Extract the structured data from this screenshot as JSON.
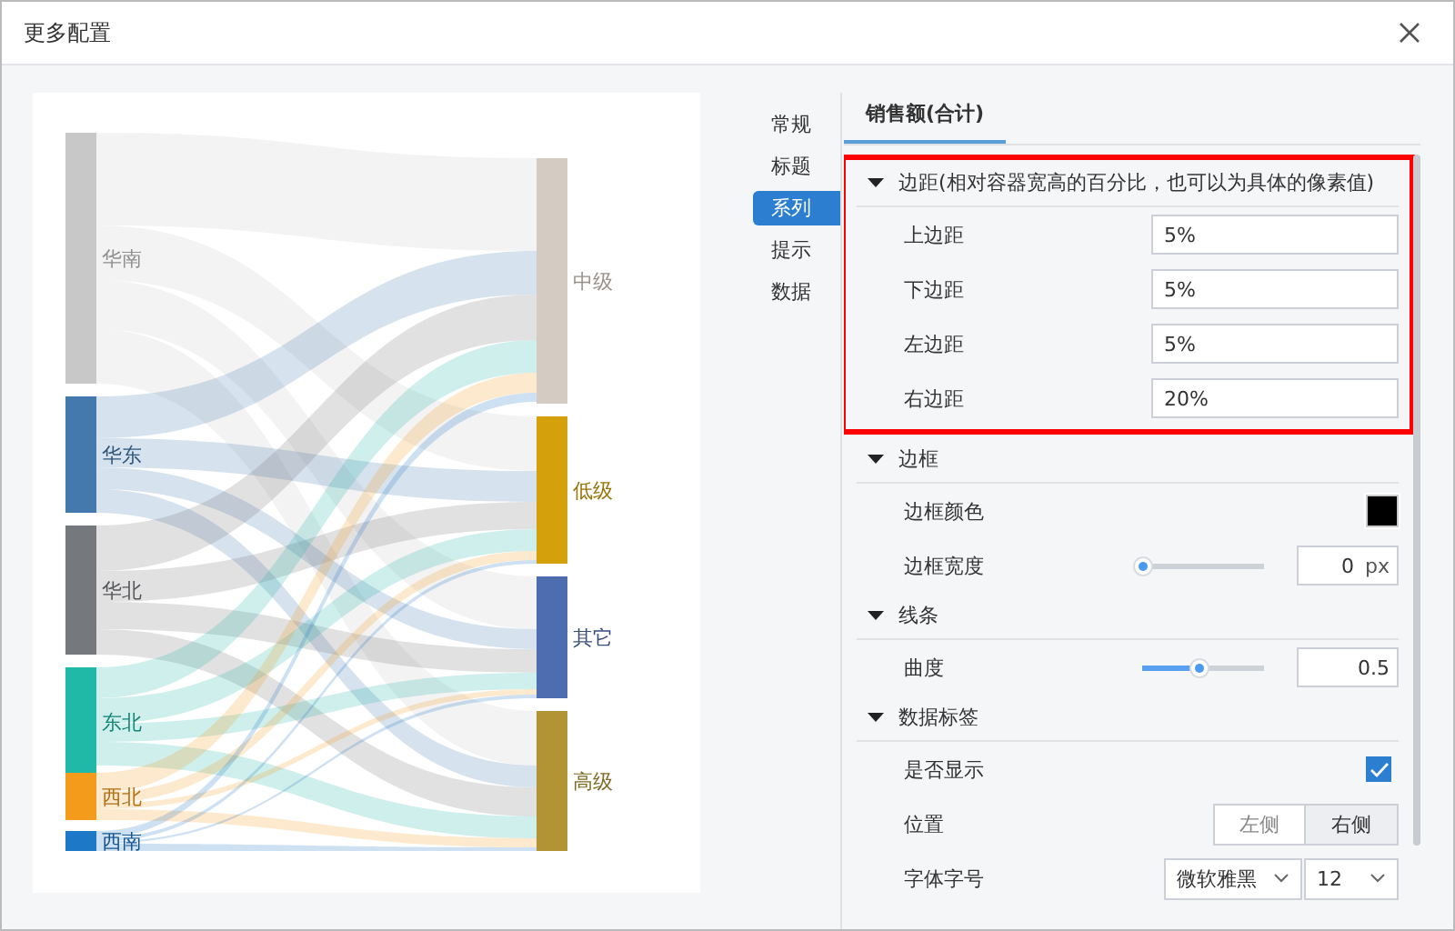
{
  "window": {
    "title": "更多配置"
  },
  "chart": {
    "sources": [
      {
        "label": "华南",
        "color": "#c8c8c8"
      },
      {
        "label": "华东",
        "color": "#4479ad"
      },
      {
        "label": "华北",
        "color": "#75787d"
      },
      {
        "label": "东北",
        "color": "#20b8a6"
      },
      {
        "label": "西北",
        "color": "#f59b1c"
      },
      {
        "label": "西南",
        "color": "#1e78c8"
      }
    ],
    "targets": [
      {
        "label": "中级",
        "color": "#d4cbc2"
      },
      {
        "label": "低级",
        "color": "#d4a10c"
      },
      {
        "label": "其它",
        "color": "#4e6cb0"
      },
      {
        "label": "高级",
        "color": "#b39434"
      }
    ]
  },
  "nav": [
    {
      "label": "常规",
      "selected": false
    },
    {
      "label": "标题",
      "selected": false
    },
    {
      "label": "系列",
      "selected": true
    },
    {
      "label": "提示",
      "selected": false
    },
    {
      "label": "数据",
      "selected": false
    }
  ],
  "tabs": [
    {
      "label": "销售额(合计)",
      "selected": true
    }
  ],
  "sections": [
    {
      "title": "边距(相对容器宽高的百分比，也可以为具体的像素值)",
      "expanded": true,
      "highlighted": true,
      "rows": [
        {
          "kind": "input",
          "label": "上边距",
          "value": "5%"
        },
        {
          "kind": "input",
          "label": "下边距",
          "value": "5%"
        },
        {
          "kind": "input",
          "label": "左边距",
          "value": "5%"
        },
        {
          "kind": "input",
          "label": "右边距",
          "value": "20%"
        }
      ]
    },
    {
      "title": "边框",
      "expanded": true,
      "highlighted": false,
      "rows": [
        {
          "kind": "color",
          "label": "边框颜色",
          "color": "#000000"
        },
        {
          "kind": "slider",
          "label": "边框宽度",
          "level": 0,
          "value": "0",
          "unit": "px"
        }
      ]
    },
    {
      "title": "线条",
      "expanded": true,
      "highlighted": false,
      "rows": [
        {
          "kind": "slider",
          "label": "曲度",
          "level": 0.5,
          "value": "0.5"
        }
      ]
    },
    {
      "title": "数据标签",
      "expanded": true,
      "highlighted": false,
      "rows": [
        {
          "kind": "checkbox",
          "label": "是否显示",
          "checked": true
        },
        {
          "kind": "segmented",
          "label": "位置",
          "options": [
            {
              "label": "左侧",
              "selected": false
            },
            {
              "label": "右侧",
              "selected": true
            }
          ]
        },
        {
          "kind": "selects",
          "label": "字体字号",
          "selects": [
            "微软雅黑",
            "12"
          ]
        }
      ]
    }
  ]
}
